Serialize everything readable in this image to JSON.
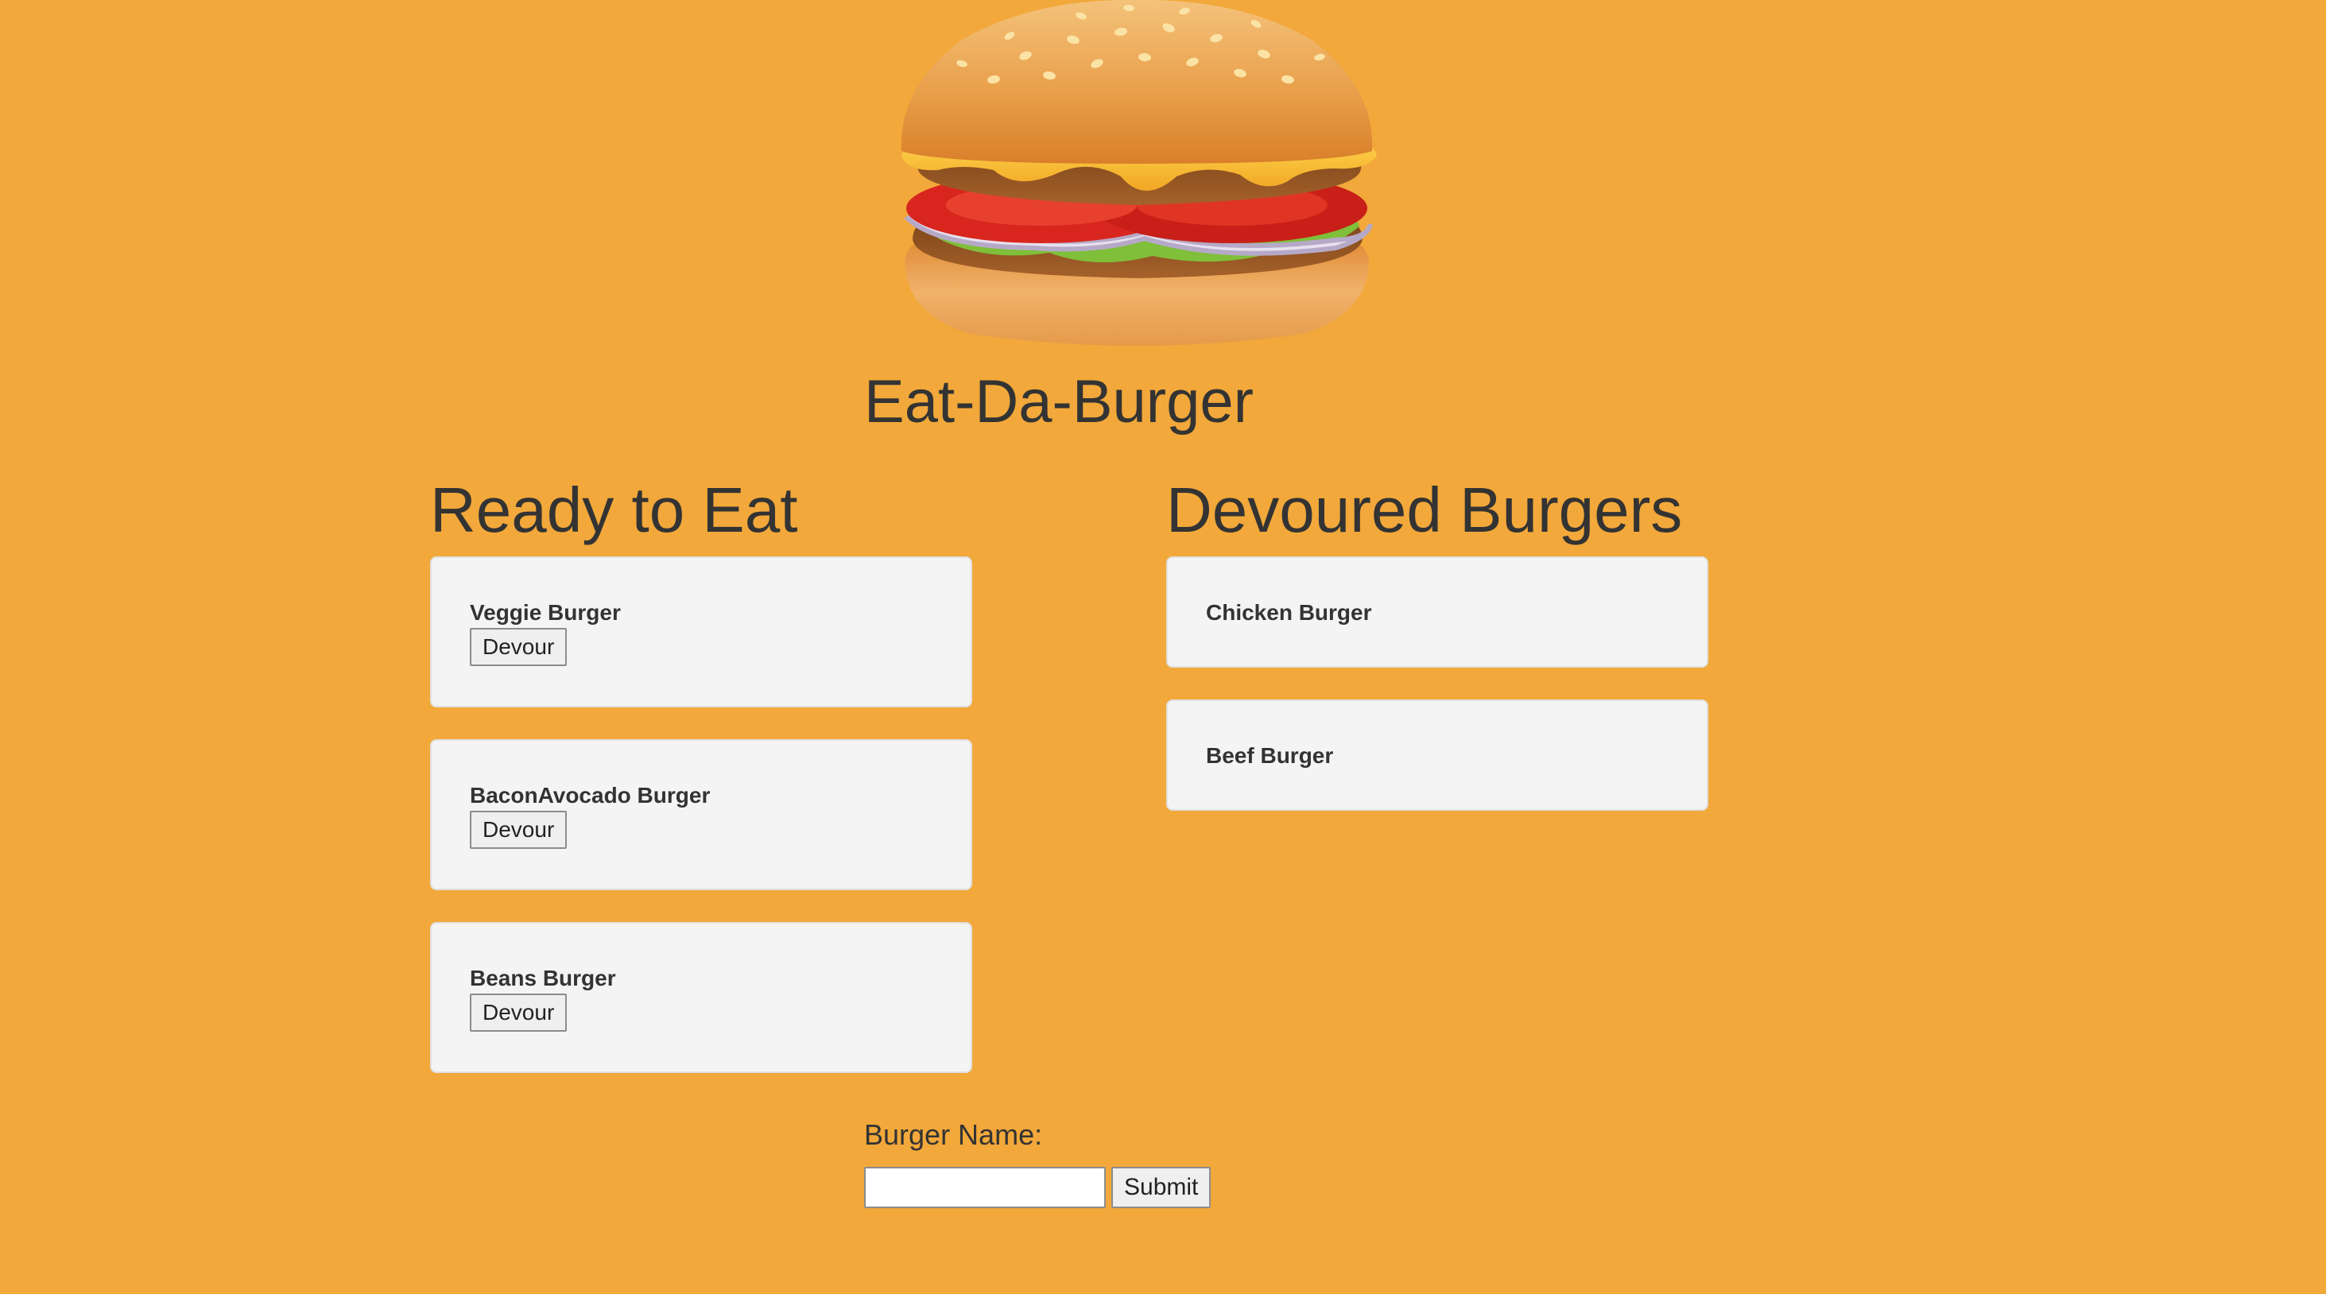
{
  "colors": {
    "background": "#f2a83a",
    "text": "#333333",
    "card_background": "#f4f4f4"
  },
  "header": {
    "logo_icon": "hamburger-icon",
    "title": "Eat-Da-Burger"
  },
  "ready": {
    "heading": "Ready to Eat",
    "items": [
      {
        "name": "Veggie Burger",
        "button_label": "Devour"
      },
      {
        "name": "BaconAvocado Burger",
        "button_label": "Devour"
      },
      {
        "name": "Beans Burger",
        "button_label": "Devour"
      }
    ]
  },
  "devoured": {
    "heading": "Devoured Burgers",
    "items": [
      {
        "name": "Chicken Burger"
      },
      {
        "name": "Beef Burger"
      }
    ]
  },
  "form": {
    "label": "Burger Name:",
    "input_value": "",
    "submit_label": "Submit"
  }
}
